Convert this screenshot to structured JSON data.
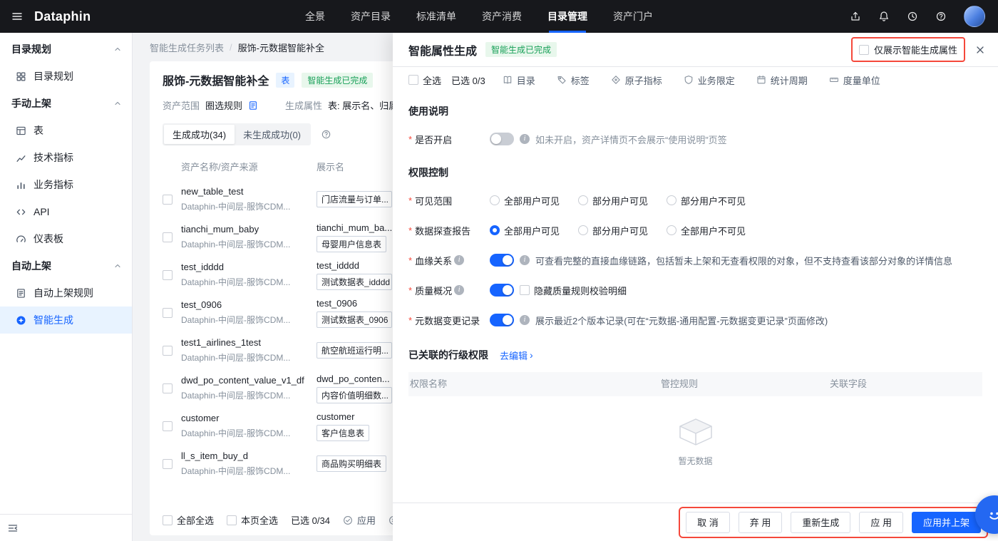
{
  "topbar": {
    "logo": "Dataphin",
    "nav": [
      "全景",
      "资产目录",
      "标准清单",
      "资产消费",
      "目录管理",
      "资产门户"
    ],
    "active_nav": "目录管理"
  },
  "sidebar": {
    "groups": [
      {
        "label": "目录规划",
        "items": [
          {
            "label": "目录规划",
            "icon": "grid-icon"
          }
        ]
      },
      {
        "label": "手动上架",
        "items": [
          {
            "label": "表",
            "icon": "table-icon"
          },
          {
            "label": "技术指标",
            "icon": "tech-metric-icon"
          },
          {
            "label": "业务指标",
            "icon": "biz-metric-icon"
          },
          {
            "label": "API",
            "icon": "api-icon"
          },
          {
            "label": "仪表板",
            "icon": "dashboard-icon"
          }
        ]
      },
      {
        "label": "自动上架",
        "items": [
          {
            "label": "自动上架规则",
            "icon": "doc-icon"
          },
          {
            "label": "智能生成",
            "icon": "smart-gen-icon",
            "active": true
          }
        ]
      }
    ]
  },
  "main": {
    "breadcrumb": {
      "parent": "智能生成任务列表",
      "separator": "/",
      "current": "服饰-元数据智能补全"
    },
    "title": "服饰-元数据智能补全",
    "type_badge": "表",
    "status_badge": "智能生成已完成",
    "scope_label": "资产范围",
    "scope_value": "圈选规则",
    "attrs_label": "生成属性",
    "attrs_value": "表: 展示名、归属目录、...",
    "tabs": [
      {
        "label": "生成成功(34)",
        "active": true
      },
      {
        "label": "未生成成功(0)",
        "active": false
      }
    ],
    "table": {
      "columns": [
        "资产名称/资产来源",
        "展示名"
      ],
      "rows": [
        {
          "name": "new_table_test",
          "source": "Dataphin-中间层-服饰CDM...",
          "display_text": "",
          "display_box": "门店流量与订单..."
        },
        {
          "name": "tianchi_mum_baby",
          "source": "Dataphin-中间层-服饰CDM...",
          "display_text": "tianchi_mum_ba...",
          "display_box": "母婴用户信息表"
        },
        {
          "name": "test_idddd",
          "source": "Dataphin-中间层-服饰CDM...",
          "display_text": "test_idddd",
          "display_box": "测试数据表_idddd"
        },
        {
          "name": "test_0906",
          "source": "Dataphin-中间层-服饰CDM...",
          "display_text": "test_0906",
          "display_box": "测试数据表_0906"
        },
        {
          "name": "test1_airlines_1test",
          "source": "Dataphin-中间层-服饰CDM...",
          "display_text": "",
          "display_box": "航空航班运行明..."
        },
        {
          "name": "dwd_po_content_value_v1_df",
          "source": "Dataphin-中间层-服饰CDM...",
          "display_text": "dwd_po_conten...",
          "display_box": "内容价值明细数..."
        },
        {
          "name": "customer",
          "source": "Dataphin-中间层-服饰CDM...",
          "display_text": "customer",
          "display_box": "客户信息表"
        },
        {
          "name": "ll_s_item_buy_d",
          "source": "Dataphin-中间层-服饰CDM...",
          "display_text": "",
          "display_box": "商品购买明细表"
        }
      ]
    },
    "footer": {
      "select_all": "全部全选",
      "select_page": "本页全选",
      "selected_count": "已选 0/34",
      "apply": "应用",
      "discard": "弃用"
    }
  },
  "drawer": {
    "title": "智能属性生成",
    "status_badge": "智能生成已完成",
    "only_smart_label": "仅展示智能生成属性",
    "filter_bar": {
      "select_all": "全选",
      "selected_count": "已选 0/3",
      "items": [
        {
          "label": "目录",
          "icon": "catalog-icon"
        },
        {
          "label": "标签",
          "icon": "tag-icon"
        },
        {
          "label": "原子指标",
          "icon": "atomic-metric-icon"
        },
        {
          "label": "业务限定",
          "icon": "business-limit-icon"
        },
        {
          "label": "统计周期",
          "icon": "stat-period-icon"
        },
        {
          "label": "度量单位",
          "icon": "unit-icon"
        }
      ]
    },
    "usage_section": {
      "title": "使用说明",
      "enable_label": "是否开启",
      "enabled": false,
      "hint": "如未开启，资产详情页不会展示“使用说明”页签"
    },
    "permission_section": {
      "title": "权限控制",
      "visible_scope": {
        "label": "可见范围",
        "options": [
          "全部用户可见",
          "部分用户可见",
          "部分用户不可见"
        ],
        "selected_index": -1
      },
      "probe_report": {
        "label": "数据探查报告",
        "options": [
          "全部用户可见",
          "部分用户可见",
          "全部用户不可见"
        ],
        "selected_index": 0
      },
      "lineage": {
        "label": "血缘关系",
        "enabled": true,
        "hint": "可查看完整的直接血缘链路，包括暂未上架和无查看权限的对象，但不支持查看该部分对象的详情信息"
      },
      "quality": {
        "label": "质量概况",
        "enabled": true,
        "option_label": "隐藏质量规则校验明细"
      },
      "meta_change": {
        "label": "元数据变更记录",
        "enabled": true,
        "hint": "展示最近2个版本记录(可在“元数据-通用配置-元数据变更记录”页面修改)"
      }
    },
    "row_permission_section": {
      "title": "已关联的行级权限",
      "edit_link": "去编辑",
      "columns": [
        "权限名称",
        "管控规则",
        "关联字段"
      ],
      "empty_text": "暂无数据"
    },
    "footer_buttons": [
      {
        "label": "取 消",
        "type": "default"
      },
      {
        "label": "弃 用",
        "type": "default"
      },
      {
        "label": "重新生成",
        "type": "default"
      },
      {
        "label": "应 用",
        "type": "default"
      },
      {
        "label": "应用并上架",
        "type": "primary"
      }
    ]
  }
}
